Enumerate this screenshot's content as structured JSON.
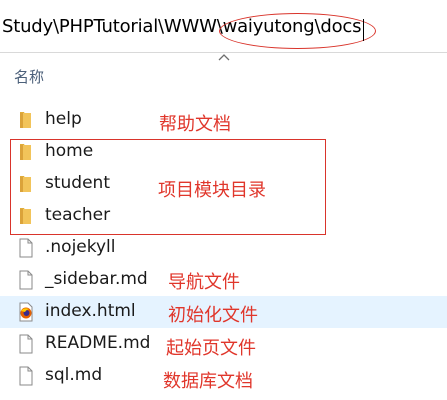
{
  "address": {
    "path": "Study\\PHPTutorial\\WWW\\waiyutong\\docs"
  },
  "header": {
    "name_column": "名称"
  },
  "files": [
    {
      "name": "help",
      "type": "folder"
    },
    {
      "name": "home",
      "type": "folder"
    },
    {
      "name": "student",
      "type": "folder"
    },
    {
      "name": "teacher",
      "type": "folder"
    },
    {
      "name": ".nojekyll",
      "type": "file"
    },
    {
      "name": "_sidebar.md",
      "type": "file"
    },
    {
      "name": "index.html",
      "type": "html"
    },
    {
      "name": "README.md",
      "type": "file"
    },
    {
      "name": "sql.md",
      "type": "file"
    }
  ],
  "annotations": {
    "help": "帮助文档",
    "modules": "项目模块目录",
    "sidebar": "导航文件",
    "index": "初始化文件",
    "readme": "起始页文件",
    "sql": "数据库文档"
  },
  "colors": {
    "annotation": "#e0362b",
    "folder": "#f2c45a",
    "selection": "#e5f3ff"
  },
  "icons": {
    "folder": "folder-icon",
    "file": "file-icon",
    "html": "firefox-html-icon",
    "sort": "chevron-up-icon"
  }
}
